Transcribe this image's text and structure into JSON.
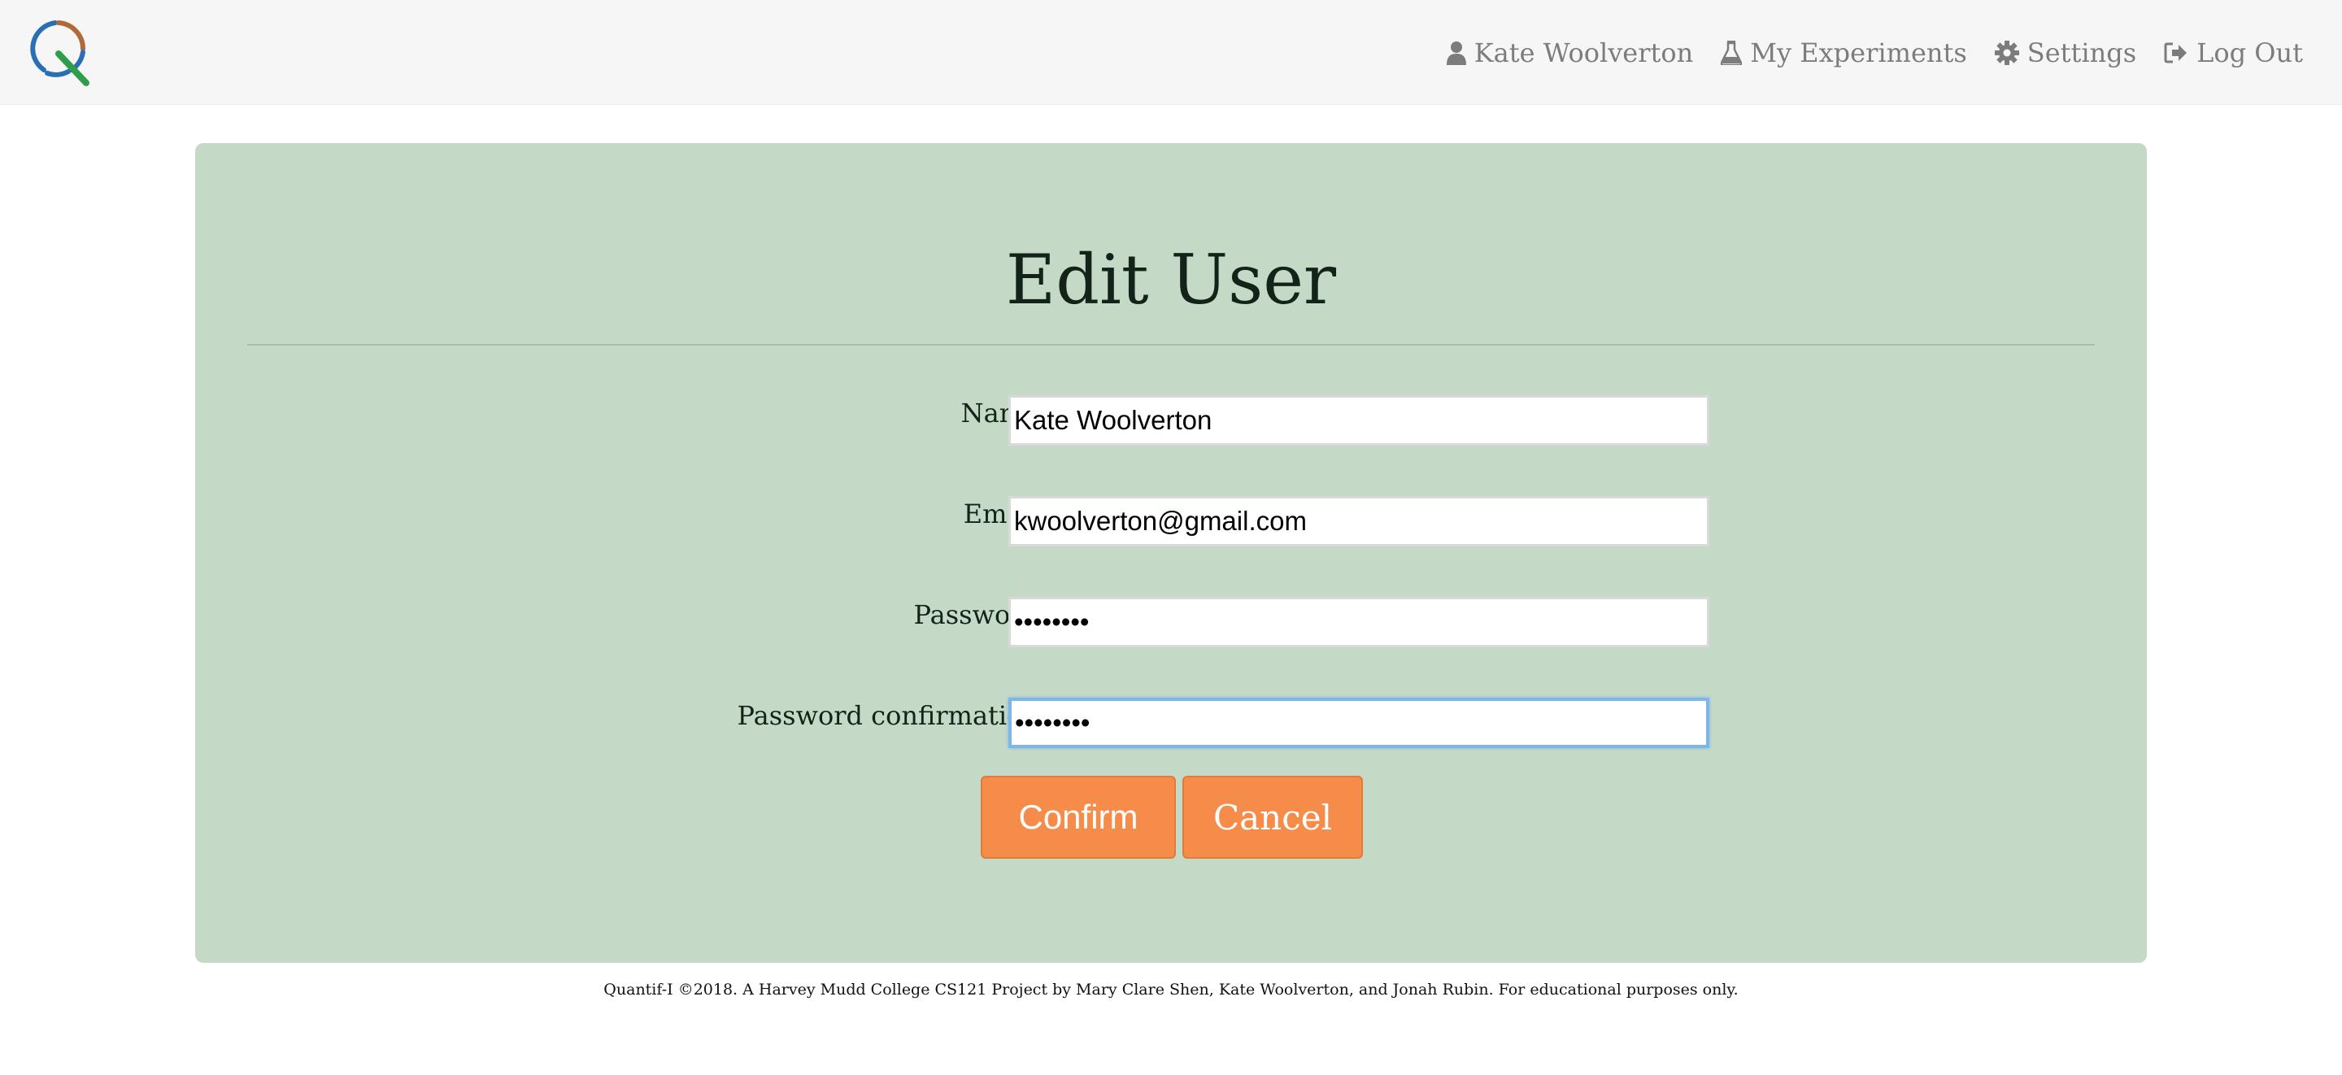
{
  "app": {
    "logo_icon": "quantif-i-logo-icon",
    "colors": {
      "navbar_bg": "#f6f6f6",
      "panel_bg": "#c4dac6",
      "button_bg": "#f68c4a",
      "focus_ring": "#7fb6ea"
    }
  },
  "nav": {
    "links": [
      {
        "label": "Kate Woolverton",
        "icon": "user-icon"
      },
      {
        "label": "My Experiments",
        "icon": "flask-icon"
      },
      {
        "label": "Settings",
        "icon": "gear-icon"
      },
      {
        "label": "Log Out",
        "icon": "sign-out-icon"
      }
    ]
  },
  "page": {
    "title": "Edit User"
  },
  "form": {
    "fields": [
      {
        "label": "Name",
        "value": "Kate Woolverton",
        "type": "text"
      },
      {
        "label": "Email",
        "value": "kwoolverton@gmail.com",
        "type": "email"
      },
      {
        "label": "Password",
        "value": "••••••••",
        "type": "password"
      },
      {
        "label": "Password confirmation",
        "value": "••••••••",
        "type": "password"
      }
    ],
    "confirm_label": "Confirm",
    "cancel_label": "Cancel"
  },
  "footer": {
    "text": "Quantif-I ©2018. A Harvey Mudd College CS121 Project by Mary Clare Shen, Kate Woolverton, and Jonah Rubin. For educational purposes only."
  }
}
